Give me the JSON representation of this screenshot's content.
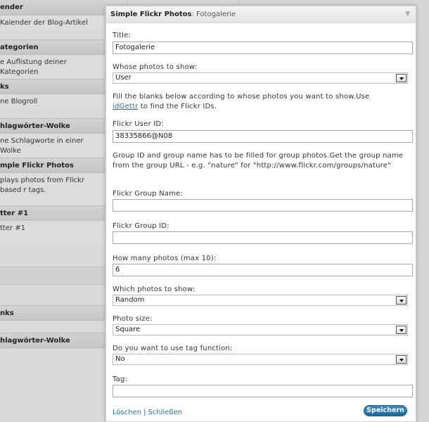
{
  "background": {
    "items": [
      {
        "title": "ender",
        "desc": "Kalender der Blog-Artikel"
      },
      {
        "title": "ategorien",
        "desc": "e Auflistung deiner Kategorien"
      },
      {
        "title": "ks",
        "desc": "ne Blogroll"
      },
      {
        "title": "hlagwörter-Wolke",
        "desc": "ne Schlagworte in einer Wolke"
      },
      {
        "title": "mple Flickr Photos",
        "desc": "plays photos from Flickr based r tags."
      },
      {
        "title": "tter #1",
        "desc": "tter #1"
      }
    ],
    "lower_items": [
      {
        "title": "nks"
      },
      {
        "title": "hlagwörter-Wolke"
      }
    ]
  },
  "panel": {
    "title_bold": "Simple Flickr Photos",
    "title_rest": ": Fotogalerie",
    "title_label": "Title:",
    "title_value": "Fotogalerie",
    "whose_label": "Whose photos to show:",
    "whose_value": "User",
    "help1_text": "Fill the blanks below according to whose photos you want to show.Use",
    "help1_link": "idGettr",
    "help1_after": " to find the Flickr IDs.",
    "user_id_label": "Flickr User ID:",
    "user_id_value": "38335866@N08",
    "help2_text": "Group ID and group name has to be filled for group photos.Get the group name from the group URL - e.g. \"nature\" for \"http://www.flickr.com/groups/nature\"",
    "group_name_label": "Flickr Group Name:",
    "group_name_value": "",
    "group_id_label": "Flickr Group ID:",
    "group_id_value": "",
    "count_label": "How many photos (max 10):",
    "count_value": "6",
    "which_label": "Which photos to show:",
    "which_value": "Random",
    "size_label": "Photo size:",
    "size_value": "Square",
    "tagfn_label": "Do you want to use tag function:",
    "tagfn_value": "No",
    "tag_label": "Tag:",
    "tag_value": "",
    "delete_label": "Löschen",
    "separator": "|",
    "close_label": "Schließen",
    "save_label": "Speichern"
  }
}
